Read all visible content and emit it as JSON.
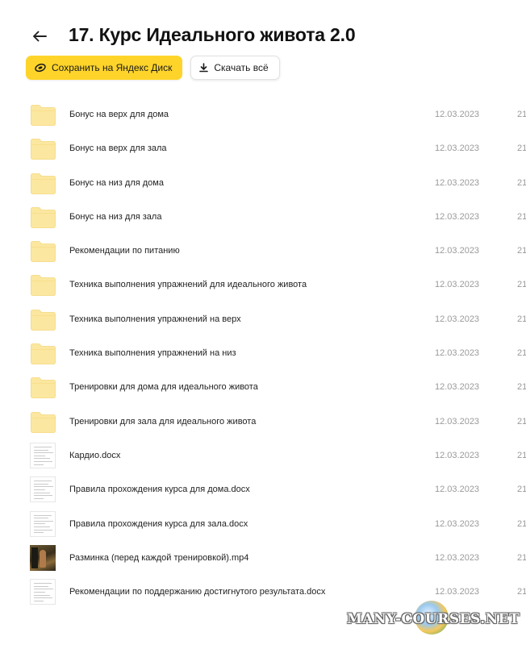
{
  "header": {
    "title": "17. Курс Идеального живота 2.0"
  },
  "actions": {
    "save_label": "Сохранить на Яндекс Диск",
    "download_label": "Скачать всё"
  },
  "files": [
    {
      "name": "Бонус на верх для дома",
      "date": "12.03.2023",
      "size": "21",
      "type": "folder"
    },
    {
      "name": "Бонус на верх для зала",
      "date": "12.03.2023",
      "size": "21",
      "type": "folder"
    },
    {
      "name": "Бонус на низ для дома",
      "date": "12.03.2023",
      "size": "21",
      "type": "folder"
    },
    {
      "name": "Бонус на низ для зала",
      "date": "12.03.2023",
      "size": "21",
      "type": "folder"
    },
    {
      "name": "Рекомендации по питанию",
      "date": "12.03.2023",
      "size": "21",
      "type": "folder"
    },
    {
      "name": "Техника выполнения упражнений для идеального живота",
      "date": "12.03.2023",
      "size": "21",
      "type": "folder"
    },
    {
      "name": "Техника выполнения упражнений на верх",
      "date": "12.03.2023",
      "size": "21",
      "type": "folder"
    },
    {
      "name": "Техника выполнения упражнений на низ",
      "date": "12.03.2023",
      "size": "21",
      "type": "folder"
    },
    {
      "name": "Тренировки для дома для идеального живота",
      "date": "12.03.2023",
      "size": "21",
      "type": "folder"
    },
    {
      "name": "Тренировки для зала для идеального живота",
      "date": "12.03.2023",
      "size": "21",
      "type": "folder"
    },
    {
      "name": "Кардио.docx",
      "date": "12.03.2023",
      "size": "21",
      "type": "doc"
    },
    {
      "name": "Правила прохождения курса для дома.docx",
      "date": "12.03.2023",
      "size": "21",
      "type": "doc"
    },
    {
      "name": "Правила прохождения курса для зала.docx",
      "date": "12.03.2023",
      "size": "21",
      "type": "doc"
    },
    {
      "name": "Разминка (перед каждой тренировкой).mp4",
      "date": "12.03.2023",
      "size": "21",
      "type": "video"
    },
    {
      "name": "Рекомендации по поддержанию достигнутого результата.docx",
      "date": "12.03.2023",
      "size": "21",
      "type": "doc"
    }
  ],
  "watermark": {
    "text": "MANY-COURSES.NET"
  },
  "colors": {
    "accent": "#fed42b",
    "folder": "#fbe7a0",
    "folder_edge": "#f5d77a",
    "meta_text": "#9a9a9a"
  }
}
